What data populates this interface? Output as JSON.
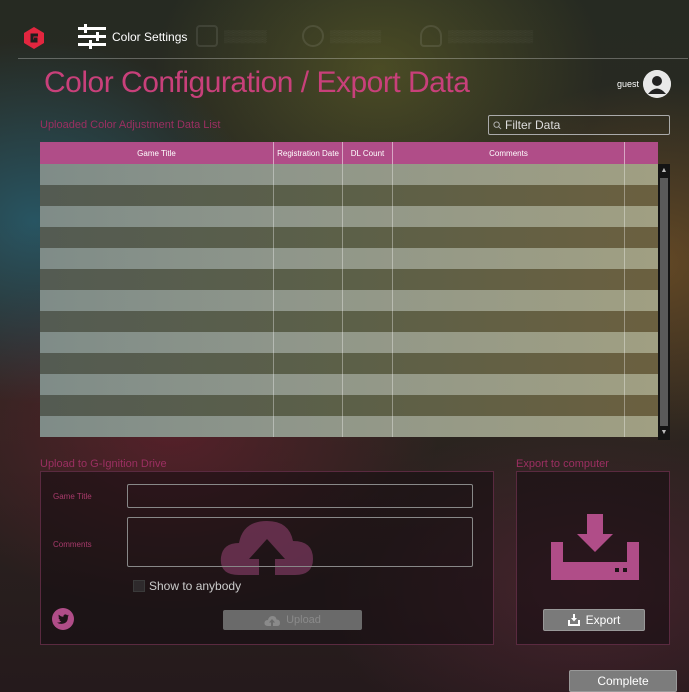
{
  "nav": {
    "active_label": "Color Settings",
    "ghost_items": [
      {
        "icon": "monitor-icon"
      },
      {
        "icon": "gear-icon"
      },
      {
        "icon": "headset-icon"
      }
    ]
  },
  "page": {
    "title": "Color Configuration / Export Data"
  },
  "user": {
    "name": "guest",
    "avatar_icon": "user-avatar-icon"
  },
  "list": {
    "title": "Uploaded Color Adjustment Data List",
    "filter_placeholder": "Filter Data",
    "columns": [
      "Game Title",
      "Registration Date",
      "DL Count",
      "Comments",
      ""
    ],
    "row_count": 13
  },
  "upload": {
    "title": "Upload to G-Ignition Drive",
    "game_title_label": "Game Title",
    "game_title_value": "",
    "comments_label": "Comments",
    "comments_value": "",
    "show_checkbox_label": "Show to anybody",
    "show_checked": false,
    "button_label": "Upload"
  },
  "export": {
    "title": "Export to computer",
    "button_label": "Export"
  },
  "footer": {
    "complete_label": "Complete"
  },
  "colors": {
    "accent": "#c8407a",
    "table_header": "#b04d88",
    "panel_border": "#5a2a40"
  }
}
